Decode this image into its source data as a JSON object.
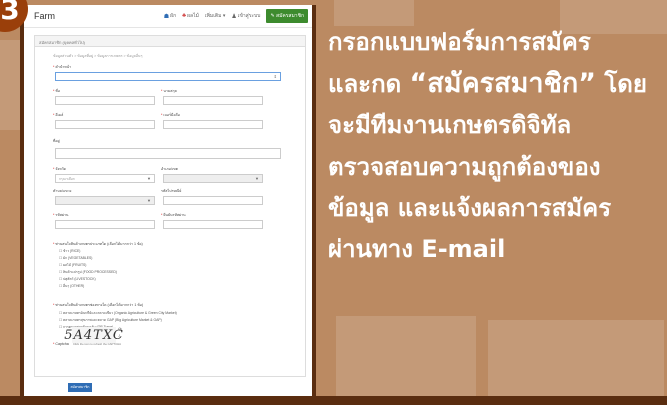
{
  "step_number": "3",
  "topbar": {
    "brand": "Farm",
    "nav": [
      {
        "icon": "☗",
        "label": "ผัก"
      },
      {
        "icon": "♣",
        "label": "ผลไม้"
      },
      {
        "icon": "",
        "label": "เพิ่มเติม ▾"
      },
      {
        "icon": "♟",
        "label": "เข้าสู่ระบบ"
      }
    ],
    "register_button": "✎ สมัครสมาชิก"
  },
  "form": {
    "panel_title": "สมัครสมาชิก (บุคคลทั่วไป)",
    "breadcrumb": "ข้อมูลส่วนตัว > ข้อมูลที่อยู่ > ข้อมูลการเกษตร > ข้อมูลอื่นๆ",
    "fields": {
      "prefix": {
        "label": "คำนำหน้า"
      },
      "first_name": {
        "label": "ชื่อ"
      },
      "last_name": {
        "label": "นามสกุล"
      },
      "email": {
        "label": "อีเมล์"
      },
      "phone": {
        "label": "เบอร์มือถือ"
      },
      "address": {
        "label": "ที่อยู่"
      },
      "province": {
        "label": "จังหวัด",
        "placeholder": "กรุณาเลือก"
      },
      "district": {
        "label": "อำเภอ/เขต"
      },
      "subdistrict": {
        "label": "ตำบล/แขวง"
      },
      "postcode": {
        "label": "รหัสไปรษณีย์"
      },
      "password": {
        "label": "รหัสผ่าน"
      },
      "confirm_password": {
        "label": "ยืนยันรหัสผ่าน"
      }
    },
    "interest_question": "ท่านสนใจสินค้าเกษตรประเภทใด (เลือกได้มากกว่า 1 ข้อ)",
    "interest_options": [
      "ข้าว (RICE)",
      "ผัก (VEGETABLES)",
      "ผลไม้ (FRUITS)",
      "สินค้าแปรรูป (FOOD PROCESSED)",
      "ปศุสัตว์ (LIVESTOCK)",
      "อื่นๆ (OTHER)"
    ],
    "channel_question": "ท่านสนใจสินค้าเกษตรช่องทางใด (เลือกได้มากกว่า 1 ข้อ)",
    "channel_options": [
      "ตลาดเกษตรอินทรีย์และตลาดเขียว (Organic Agriculture & Green City Market)",
      "ตลาดเกษตรสุขภาพและตลาด GAP (Big Agriculture Market & GAP)",
      "การตรวจสอบย้อนกลับ (QR Trace)"
    ],
    "captcha_label": "Captcha",
    "captcha_text": "5A4TXC",
    "captcha_note": "Click the icon to refresh the CAPTCHA",
    "submit_label": "สมัครสมาชิก"
  },
  "instructions": {
    "lines": [
      "กรอกแบบฟอร์มการสมัคร",
      "และกด ",
      "จะมีทีมงานเกษตรดิจิทัล",
      "ตรวจสอบความถูกต้องของ",
      "ข้อมูล และแจ้งผลการสมัคร",
      "ผ่านทาง E-mail"
    ],
    "highlight": "“สมัครสมาชิก”",
    "after_highlight": " โดย"
  }
}
